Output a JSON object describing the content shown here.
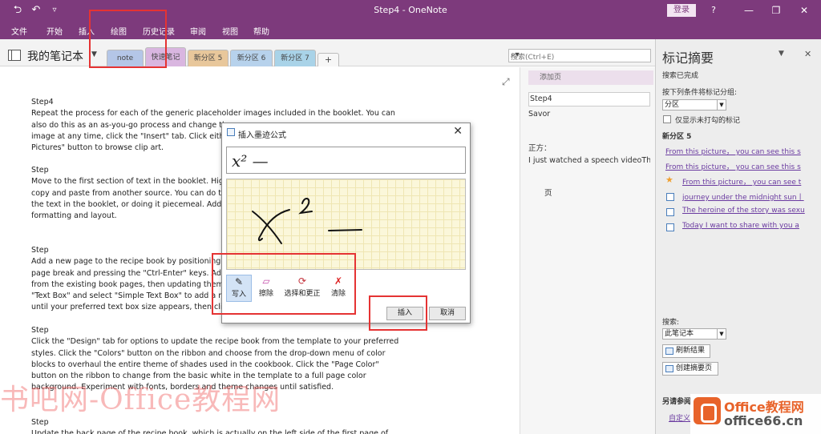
{
  "titlebar": {
    "title": "Step4 - OneNote",
    "login": "登录",
    "back_glyph": "⮌",
    "undo_glyph": "↶",
    "qa_more_glyph": "▿",
    "help_glyph": "?",
    "min_glyph": "—",
    "restore_glyph": "❐",
    "close_glyph": "✕"
  },
  "menu": [
    "文件",
    "开始",
    "插入",
    "绘图",
    "历史记录",
    "审阅",
    "视图",
    "帮助"
  ],
  "notebook": {
    "title": "我的笔记本",
    "arrow": "▼"
  },
  "sections": [
    {
      "label": "note",
      "color": "#b4c6e7"
    },
    {
      "label": "快速笔记",
      "color": "#d9b6e0"
    },
    {
      "label": "新分区 5",
      "color": "#e8c79b"
    },
    {
      "label": "新分区 6",
      "color": "#b7d2ec"
    },
    {
      "label": "新分区 7",
      "color": "#a9d3e8"
    },
    {
      "label": "+",
      "color": "#f7f7f7"
    }
  ],
  "search": {
    "placeholder": "搜索(Ctrl+E)",
    "icon": "⌕▾"
  },
  "page": {
    "expand_icon": "⤢",
    "blocks": [
      "Step4\nRepeat the process for each of the generic placeholder images included in the booklet. You can\nalso do this as an as-you-go process and change th\nimage at any time, click the \"Insert\" tab. Click eith\nPictures\" button to browse clip art.",
      "Step\nMove to the first section of text in the booklet. Hig\ncopy and paste from another source. You can do t\nthe text in the booklet, or doing it piecemeal. Add\nformatting and layout.",
      "Step\nAdd a new page to the recipe book by positioning\npage break and pressing the \"Ctrl-Enter\" keys. Ad\nfrom the existing book pages, then updating them\n\"Text Box\" and select \"Simple Text Box\" to add a n\nuntil your preferred text box size appears, then cli",
      "Step\nClick the \"Design\" tab for options to update the recipe book from the template to your preferred\nstyles. Click the \"Colors\" button on the ribbon and choose from the drop-down menu of color\nblocks to overhaul the entire theme of shades used in the cookbook. Click the \"Page Color\"\nbutton on the ribbon to change from the basic white in the template to a full page color\nbackground. Experiment with fonts, borders and theme changes until satisfied.",
      "Step\nUpdate the back page of the recipe book, which is actually on the left side of the first page of"
    ]
  },
  "pages_panel": {
    "add_page": "添加页",
    "items": [
      "Step4",
      "Savor",
      "正方：",
      "I just watched a speech videoTh",
      "页"
    ]
  },
  "tags": {
    "title": "标记摘要",
    "pin_icon": "▼",
    "close_icon": "✕",
    "status": "搜索已完成",
    "group_label": "按下列条件将标记分组:",
    "group_value": "分区",
    "show_unchecked": "仅显示未打勾的标记",
    "section": "新分区 5",
    "links": [
      {
        "text": "From this picture， you can see this s",
        "mark": "none"
      },
      {
        "text": "From this picture， you can see this s",
        "mark": "none"
      },
      {
        "text": "From this picture， you can see t",
        "mark": "star"
      },
      {
        "text": "journey under the midnight sun丨",
        "mark": "checkbox"
      },
      {
        "text": "The heroine of the story was sexu",
        "mark": "checkbox"
      },
      {
        "text": "Today I want to share with you a",
        "mark": "checkbox"
      }
    ],
    "search_label": "搜索:",
    "search_value": "此笔记本",
    "refresh": "刷新结果",
    "create": "创建摘要页",
    "see_also": "另请参阅",
    "custom": "自定义"
  },
  "dialog": {
    "title": "插入墨迹公式",
    "close": "✕",
    "preview": "x² —",
    "tools": [
      {
        "label": "写入",
        "icon": "✎",
        "active": true
      },
      {
        "label": "擦除",
        "icon": "▱",
        "active": false
      },
      {
        "label": "选择和更正",
        "icon": "⟳",
        "active": false
      },
      {
        "label": "清除",
        "icon": "✗",
        "active": false
      }
    ],
    "insert": "插入",
    "cancel": "取消"
  },
  "watermark": "书吧网-Office教程网",
  "brand": {
    "line1": "Office教程网",
    "line2": "office66.cn"
  }
}
